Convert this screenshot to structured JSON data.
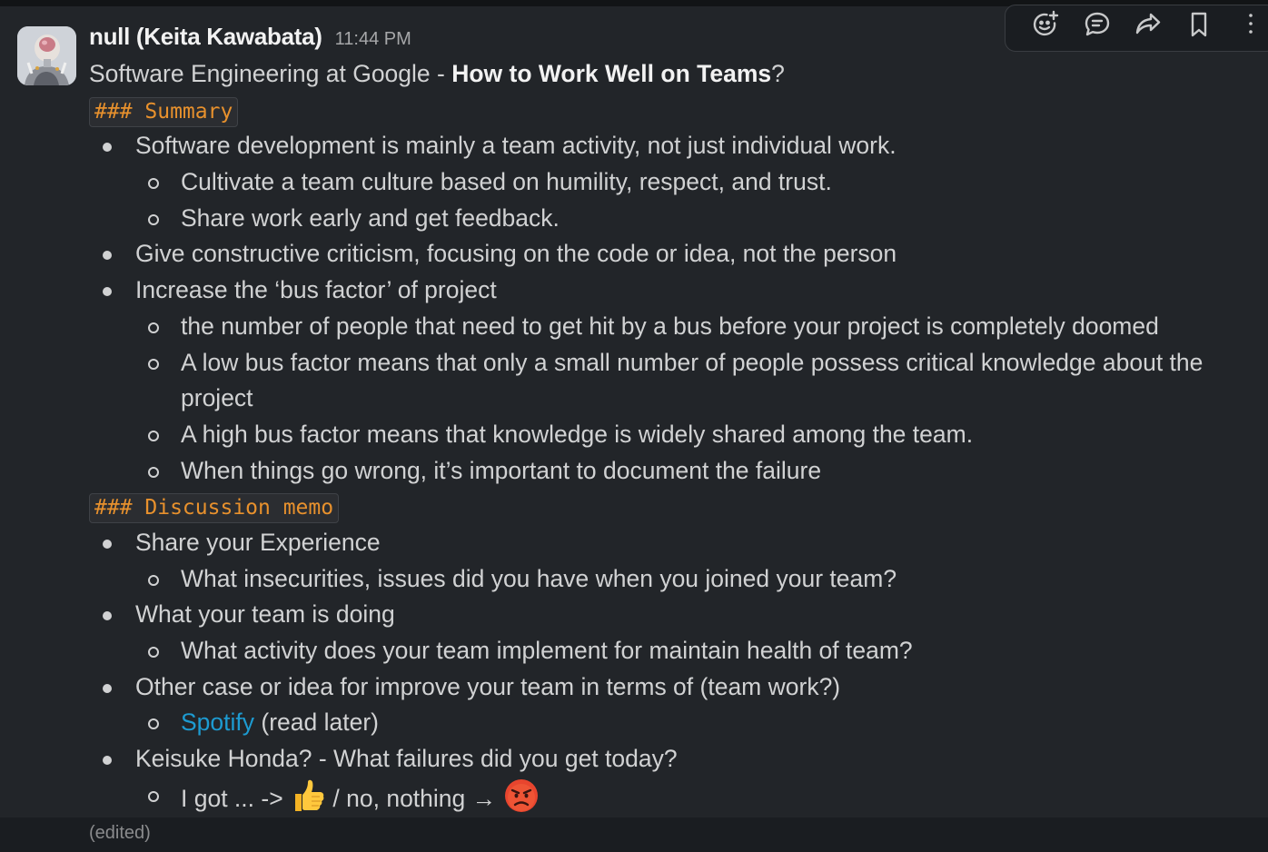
{
  "message": {
    "author": "null (Keita Kawabata)",
    "time": "11:44 PM",
    "avatar_icon": "robot-portrait-avatar",
    "title_prefix": "Software Engineering at Google - ",
    "title_bold": "How to Work Well on Teams",
    "title_suffix": "?",
    "summary_heading": "### Summary",
    "summary": [
      {
        "text": "Software development is mainly a team activity, not just individual work.",
        "sub": [
          "Cultivate a team culture based on humility, respect, and trust.",
          "Share work early and get feedback."
        ]
      },
      {
        "text": "Give constructive criticism, focusing on the code or idea, not the person",
        "sub": []
      },
      {
        "text": "Increase the ‘bus factor’ of project",
        "sub": [
          "the number of people that need to get hit by a bus before your project is completely doomed",
          "A low bus factor means that only a small number of people possess critical knowledge about the project",
          "A high bus factor means that knowledge is widely shared among the team.",
          "When things go wrong, it’s important to document the failure"
        ]
      }
    ],
    "discussion_heading": "### Discussion memo",
    "discussion": [
      {
        "text": "Share your Experience",
        "sub": [
          "What insecurities, issues did you have when you joined your team?"
        ]
      },
      {
        "text": "What your team is doing",
        "sub": [
          "What activity does your team implement for maintain health of team?"
        ]
      },
      {
        "text": "Other case or idea for improve your team in terms of (team work?)",
        "sub_link": "Spotify",
        "sub_link_suffix": " (read later)"
      },
      {
        "text": "Keisuke Honda? - What failures did you get today?",
        "sub_emoji_line": {
          "part1": "I got ... -> ",
          "emoji1": "thumbs-up-emoji",
          "part2": " / no, nothing → ",
          "emoji2": "angry-face-emoji"
        }
      }
    ],
    "edited": "(edited)"
  },
  "toolbar": {
    "items": [
      "add-reaction-icon",
      "reply-in-thread-icon",
      "share-icon",
      "bookmark-icon",
      "more-actions-icon"
    ]
  },
  "colors": {
    "background": "#222529",
    "code_text": "#e8912d",
    "link": "#1d9bd1",
    "author": "#f2f2f2"
  }
}
